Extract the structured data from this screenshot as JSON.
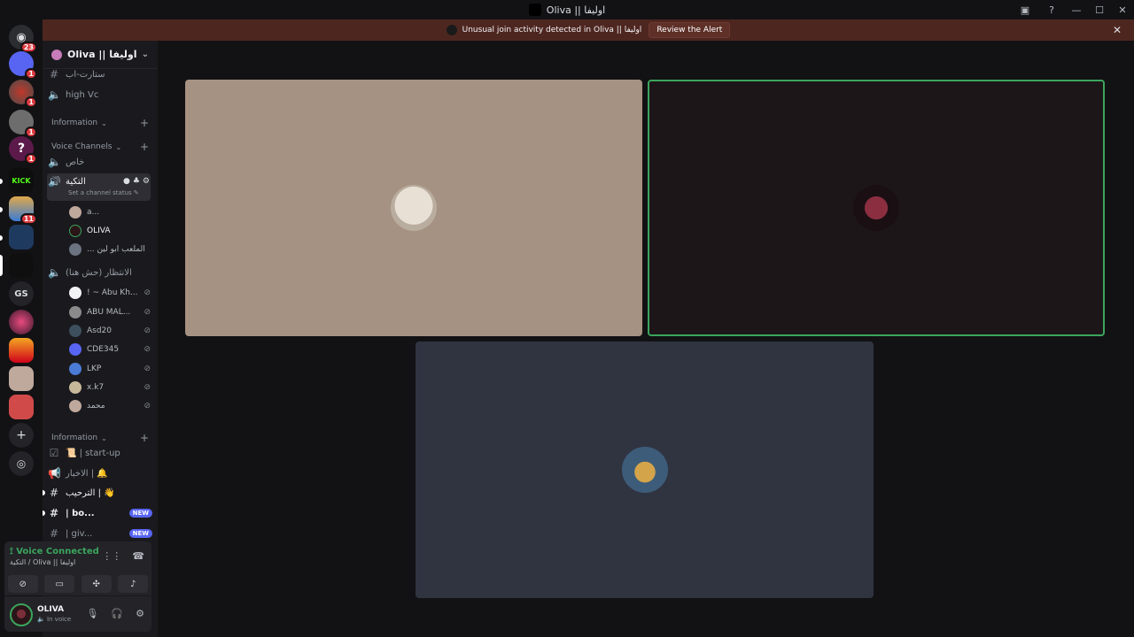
{
  "window": {
    "title": "Oliva || اوليفا"
  },
  "alert": {
    "message": "Unusual join activity detected in Oliva || اوليفا",
    "action_label": "Review the Alert"
  },
  "rail": {
    "badges": {
      "dm": "23",
      "s1": "1",
      "s2": "1",
      "s3": "1",
      "s4": "1",
      "s5": "11"
    },
    "kick_label": "KICK",
    "gs_label": "GS"
  },
  "server": {
    "name": "Oliva || اوليفا"
  },
  "channels": {
    "top_partial": "ستارت-اب",
    "high_vc": "high Vc",
    "cat_info_1": "Information",
    "cat_voice": "Voice Channels",
    "ch_khas": "خاص",
    "ch_active": "التكية",
    "ch_active_status": "Set a channel status",
    "ch_wait": "الانتظار (حش هنا)",
    "cat_info_2": "Information",
    "ch_startup": "📜 | start-up",
    "ch_news": "الاخبار | 🔔",
    "ch_welcome": "الترحيب | 👋",
    "ch_bo": "| bo...",
    "ch_giv": "| giv...",
    "new_label": "NEW"
  },
  "users_active": [
    {
      "name": "a..."
    },
    {
      "name": "OLIVA"
    },
    {
      "name": "... الملعب ابو لين"
    }
  ],
  "users_wait": [
    {
      "name": "! ~ Abu Kh..."
    },
    {
      "name": "ABU MAL..."
    },
    {
      "name": "Asd20"
    },
    {
      "name": "CDE345"
    },
    {
      "name": "LKP"
    },
    {
      "name": "x.k7"
    },
    {
      "name": "محمد"
    }
  ],
  "voice": {
    "status": "Voice Connected",
    "location": "التكية / Oliva || اوليفا"
  },
  "user": {
    "name": "OLIVA",
    "status": "In voice"
  },
  "colors": {
    "accent_green": "#3ba55c",
    "alert_bg": "#4e2620",
    "new_badge": "#5865f2"
  }
}
